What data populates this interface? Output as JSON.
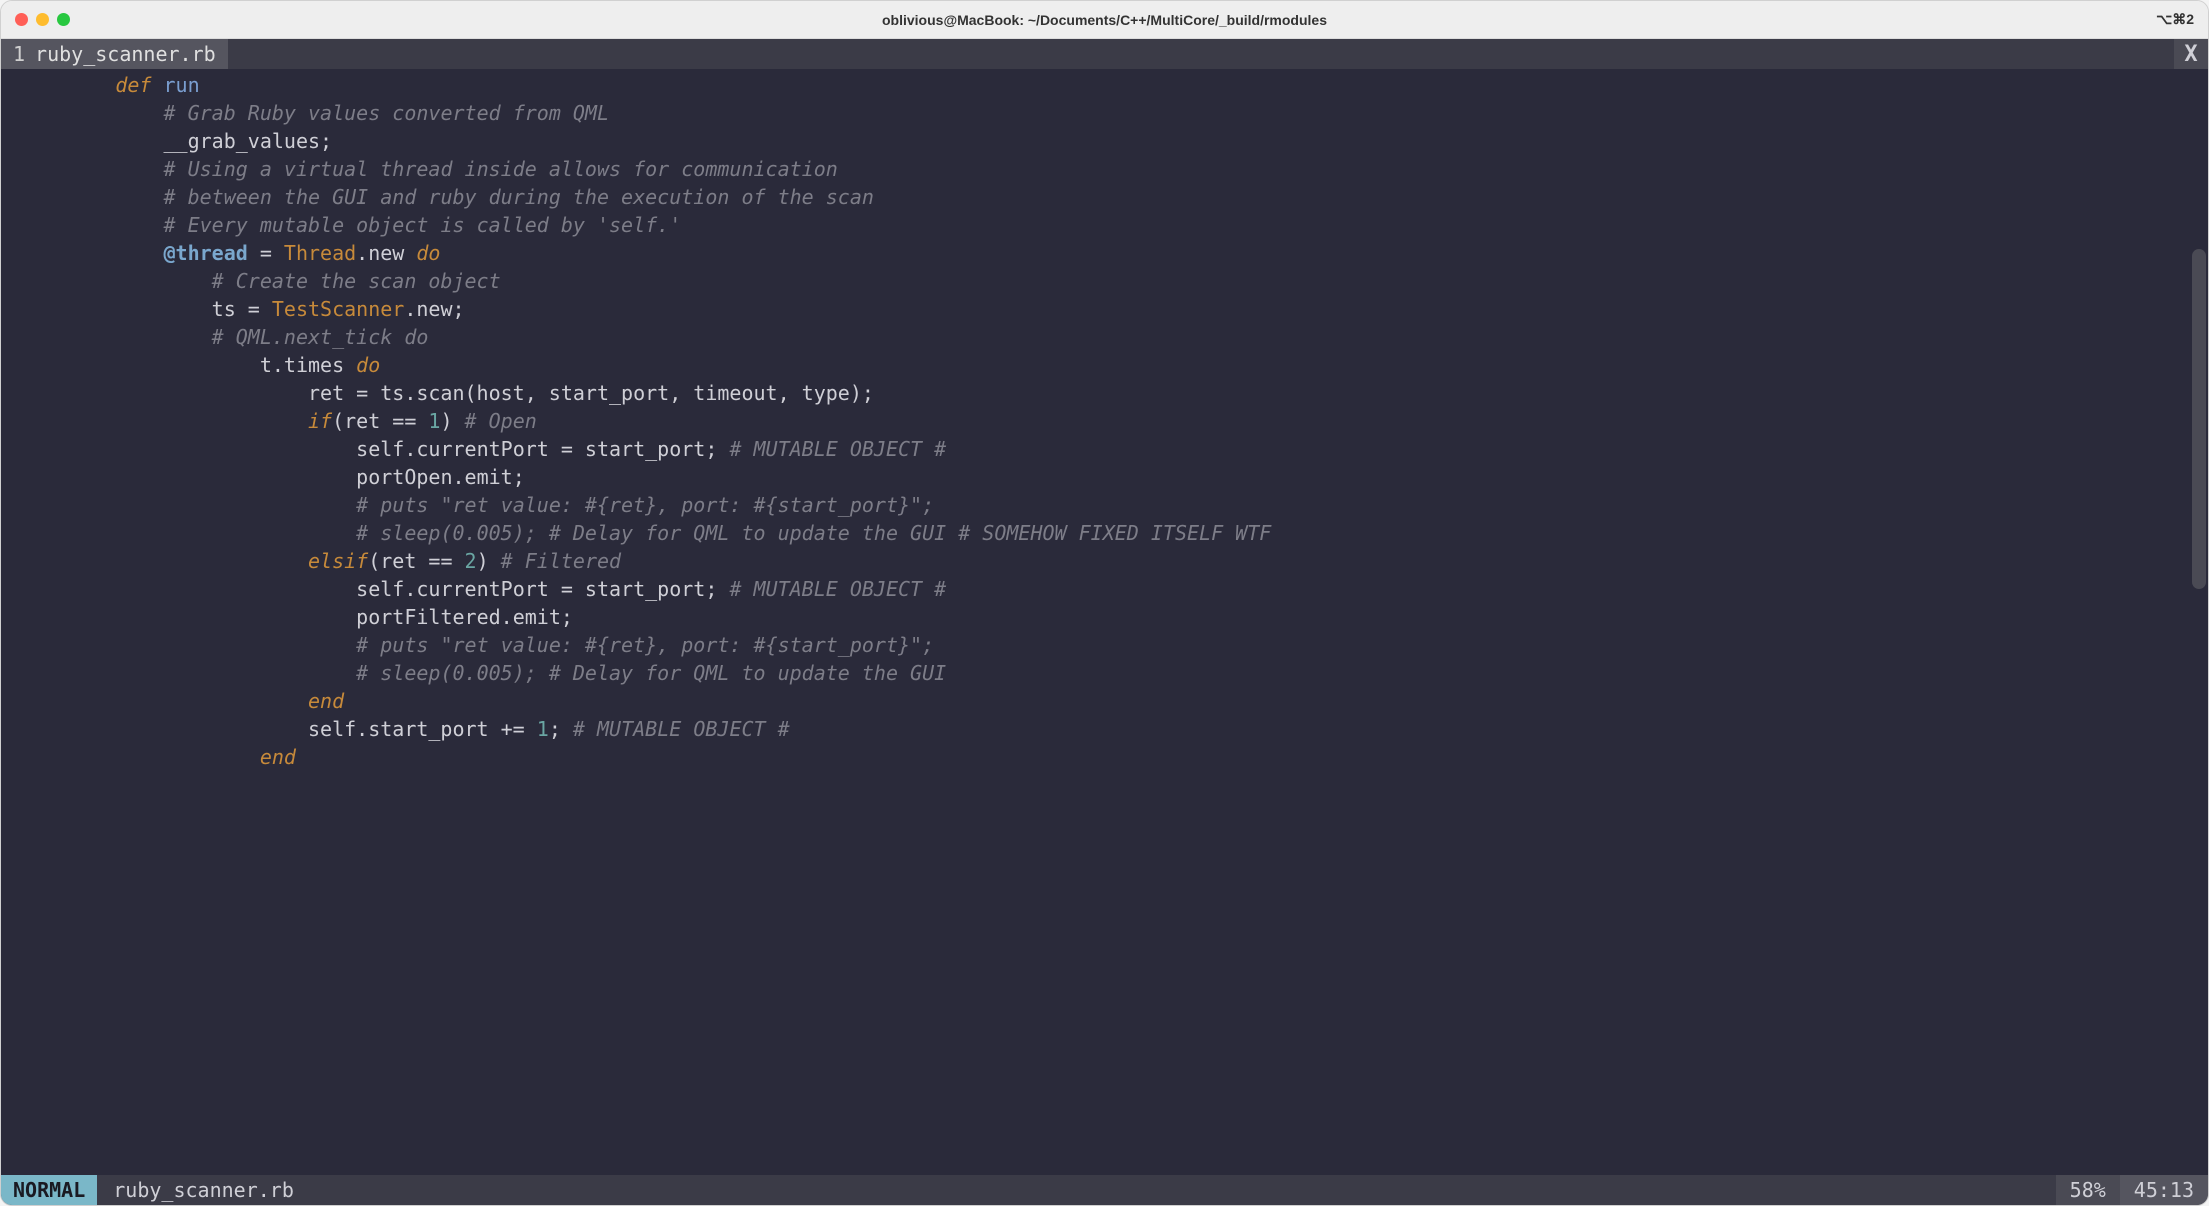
{
  "window": {
    "title": "oblivious@MacBook: ~/Documents/C++/MultiCore/_build/rmodules",
    "shortcut": "⌥⌘2"
  },
  "tabbar": {
    "index": "1",
    "filename": "ruby_scanner.rb",
    "close": "X"
  },
  "code": {
    "lines": [
      {
        "indent": 8,
        "segs": [
          {
            "c": "kw",
            "t": "def"
          },
          {
            "t": " "
          },
          {
            "c": "fn",
            "t": "run"
          }
        ]
      },
      {
        "indent": 12,
        "segs": [
          {
            "c": "cm",
            "t": "# Grab Ruby values converted from QML"
          }
        ]
      },
      {
        "indent": 12,
        "segs": [
          {
            "t": "__grab_values;"
          }
        ]
      },
      {
        "indent": 0,
        "segs": [
          {
            "t": ""
          }
        ]
      },
      {
        "indent": 12,
        "segs": [
          {
            "c": "cm",
            "t": "# Using a virtual thread inside allows for communication"
          }
        ]
      },
      {
        "indent": 12,
        "segs": [
          {
            "c": "cm",
            "t": "# between the GUI and ruby during the execution of the scan"
          }
        ]
      },
      {
        "indent": 0,
        "segs": [
          {
            "t": ""
          }
        ]
      },
      {
        "indent": 12,
        "segs": [
          {
            "c": "cm",
            "t": "# Every mutable object is called by 'self.'"
          }
        ]
      },
      {
        "indent": 12,
        "segs": [
          {
            "c": "iv",
            "t": "@thread"
          },
          {
            "t": " = "
          },
          {
            "c": "cls",
            "t": "Thread"
          },
          {
            "t": ".new "
          },
          {
            "c": "kw",
            "t": "do"
          }
        ]
      },
      {
        "indent": 16,
        "segs": [
          {
            "c": "cm",
            "t": "# Create the scan object"
          }
        ]
      },
      {
        "indent": 16,
        "segs": [
          {
            "t": "ts = "
          },
          {
            "c": "cls",
            "t": "TestScanner"
          },
          {
            "t": ".new;"
          }
        ]
      },
      {
        "indent": 16,
        "segs": [
          {
            "c": "cm",
            "t": "# QML.next_tick do"
          }
        ]
      },
      {
        "indent": 20,
        "segs": [
          {
            "t": "t.times "
          },
          {
            "c": "kw",
            "t": "do"
          }
        ]
      },
      {
        "indent": 24,
        "segs": [
          {
            "t": "ret = ts.scan(host, start_port, timeout, type);"
          }
        ]
      },
      {
        "indent": 24,
        "segs": [
          {
            "c": "kw",
            "t": "if"
          },
          {
            "t": "(ret == "
          },
          {
            "c": "num",
            "t": "1"
          },
          {
            "t": ") "
          },
          {
            "c": "cm",
            "t": "# Open"
          }
        ]
      },
      {
        "indent": 28,
        "segs": [
          {
            "t": "self.currentPort = start_port; "
          },
          {
            "c": "cm",
            "t": "# MUTABLE OBJECT #"
          }
        ]
      },
      {
        "indent": 28,
        "segs": [
          {
            "t": "portOpen.emit;"
          }
        ]
      },
      {
        "indent": 28,
        "segs": [
          {
            "c": "cm",
            "t": "# puts \"ret value: #{ret}, port: #{start_port}\";"
          }
        ]
      },
      {
        "indent": 28,
        "segs": [
          {
            "c": "cm",
            "t": "# sleep(0.005); # Delay for QML to update the GUI # SOMEHOW FIXED ITSELF WTF"
          }
        ]
      },
      {
        "indent": 24,
        "segs": [
          {
            "c": "kw",
            "t": "elsif"
          },
          {
            "t": "(ret == "
          },
          {
            "c": "num",
            "t": "2"
          },
          {
            "t": ") "
          },
          {
            "c": "cm",
            "t": "# Filtered"
          }
        ]
      },
      {
        "indent": 28,
        "segs": [
          {
            "t": "self.currentPort = start_port; "
          },
          {
            "c": "cm",
            "t": "# MUTABLE OBJECT #"
          }
        ]
      },
      {
        "indent": 28,
        "segs": [
          {
            "t": "portFiltered.emit;"
          }
        ]
      },
      {
        "indent": 28,
        "segs": [
          {
            "c": "cm",
            "t": "# puts \"ret value: #{ret}, port: #{start_port}\";"
          }
        ]
      },
      {
        "indent": 28,
        "segs": [
          {
            "c": "cm",
            "t": "# sleep(0.005); # Delay for QML to update the GUI"
          }
        ]
      },
      {
        "indent": 24,
        "segs": [
          {
            "c": "kw",
            "t": "end"
          }
        ]
      },
      {
        "indent": 24,
        "segs": [
          {
            "t": "self.start_port += "
          },
          {
            "c": "num",
            "t": "1"
          },
          {
            "t": "; "
          },
          {
            "c": "cm",
            "t": "# MUTABLE OBJECT #"
          }
        ]
      },
      {
        "indent": 20,
        "segs": [
          {
            "c": "kw",
            "t": "end"
          }
        ]
      }
    ]
  },
  "status": {
    "mode": "NORMAL",
    "file": "ruby_scanner.rb",
    "percent": "58%",
    "position": "45:13"
  }
}
